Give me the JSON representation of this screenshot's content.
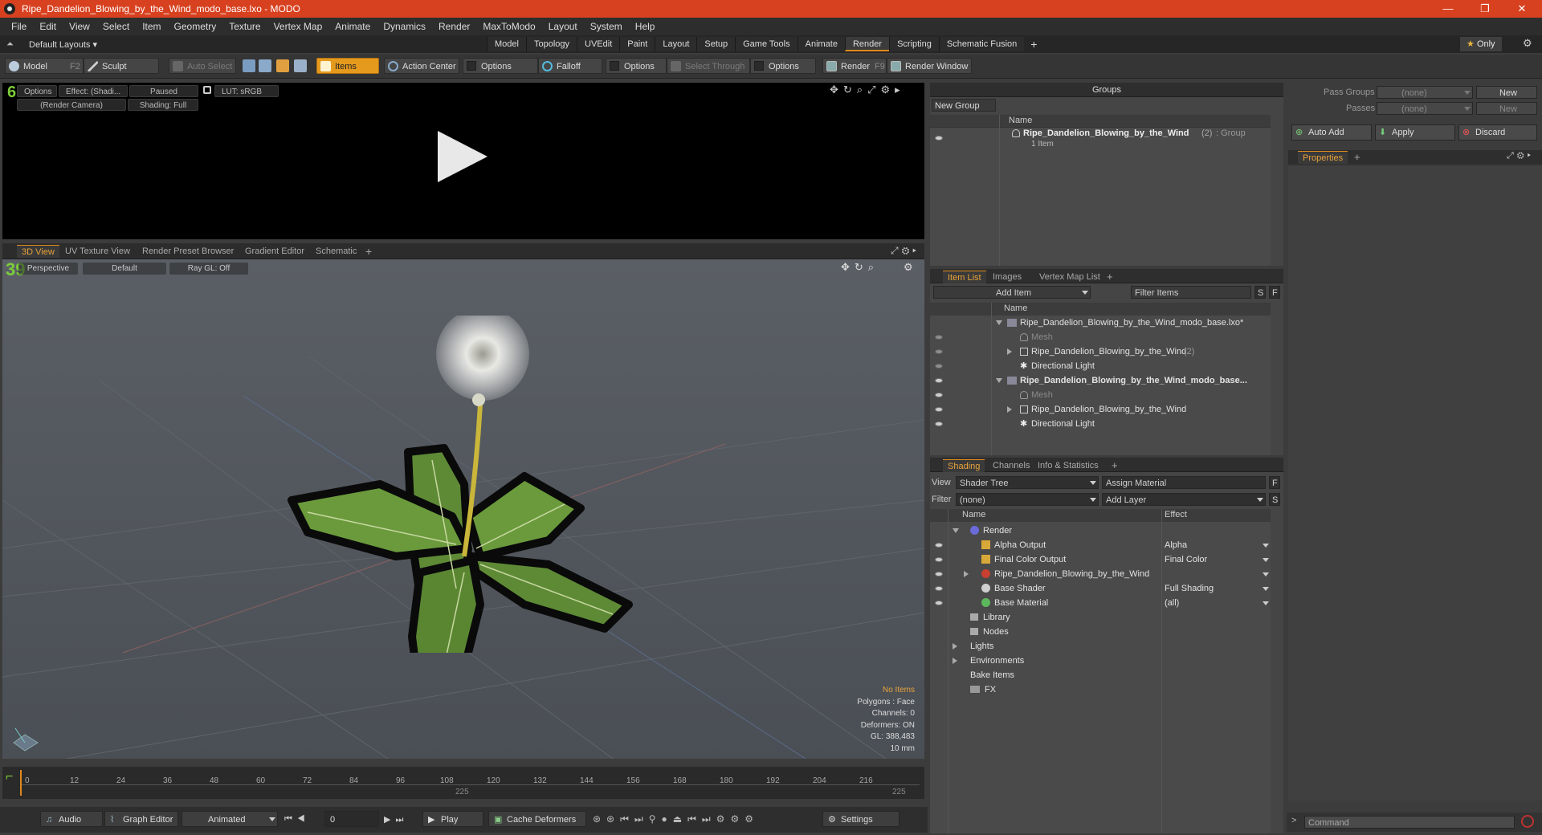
{
  "titlebar": {
    "title": "Ripe_Dandelion_Blowing_by_the_Wind_modo_base.lxo - MODO",
    "minimize": "—",
    "restore": "❐",
    "close": "✕"
  },
  "menu": [
    "File",
    "Edit",
    "View",
    "Select",
    "Item",
    "Geometry",
    "Texture",
    "Vertex Map",
    "Animate",
    "Dynamics",
    "Render",
    "MaxToModo",
    "Layout",
    "System",
    "Help"
  ],
  "layoutbar": {
    "layouts_label": "Default Layouts",
    "tabs": [
      "Model",
      "Topology",
      "UVEdit",
      "Paint",
      "Layout",
      "Setup",
      "Game Tools",
      "Animate",
      "Render",
      "Scripting",
      "Schematic Fusion"
    ],
    "active_tab": "Render",
    "only_label": "Only"
  },
  "toolbar": {
    "model": "Model",
    "model_key": "F2",
    "sculpt": "Sculpt",
    "auto_select": "Auto Select",
    "items": "Items",
    "action_center": "Action Center",
    "options1": "Options",
    "falloff": "Falloff",
    "options2": "Options",
    "select_through": "Select Through",
    "options3": "Options",
    "render": "Render",
    "render_key": "F9",
    "render_window": "Render Window"
  },
  "renderview": {
    "options": "Options",
    "effect": "Effect: (Shadi...",
    "paused": "Paused",
    "lut": "LUT: sRGB",
    "camera": "(Render Camera)",
    "shading": "Shading: Full",
    "corner_num": "6"
  },
  "viewtabs": [
    "3D View",
    "UV Texture View",
    "Render Preset Browser",
    "Gradient Editor",
    "Schematic"
  ],
  "viewport": {
    "perspective": "Perspective",
    "default": "Default",
    "raygl": "Ray GL: Off",
    "corner_num": "39"
  },
  "hud": {
    "no_items": "No Items",
    "polygons": "Polygons : Face",
    "channels": "Channels: 0",
    "deformers": "Deformers: ON",
    "gl": "GL: 388,483",
    "scale": "10 mm"
  },
  "timeline": {
    "ticks": [
      "0",
      "12",
      "24",
      "36",
      "48",
      "60",
      "72",
      "84",
      "96",
      "108",
      "120",
      "132",
      "144",
      "156",
      "168",
      "180",
      "192",
      "204",
      "216"
    ],
    "end_a": "225",
    "end_b": "225"
  },
  "bottombar": {
    "audio": "Audio",
    "graph_editor": "Graph Editor",
    "animated": "Animated",
    "frame": "0",
    "play": "Play",
    "cache_deformers": "Cache Deformers",
    "settings": "Settings"
  },
  "groups": {
    "title": "Groups",
    "new_group": "New Group",
    "col_name": "Name",
    "row_name": "Ripe_Dandelion_Blowing_by_the_Wind",
    "row_count": "(2)",
    "row_type": ": Group",
    "row_sub": "1 Item"
  },
  "itemlist": {
    "tabs": [
      "Item List",
      "Images",
      "Vertex Map List"
    ],
    "add_item": "Add Item",
    "filter_items": "Filter Items",
    "col_name": "Name",
    "rows": [
      {
        "label": "Ripe_Dandelion_Blowing_by_the_Wind_modo_base.lxo*",
        "bold": false
      },
      {
        "label": "Mesh",
        "dim": true
      },
      {
        "label": "Ripe_Dandelion_Blowing_by_the_Wind",
        "suffix": "(2)"
      },
      {
        "label": "Directional Light"
      },
      {
        "label": "Ripe_Dandelion_Blowing_by_the_Wind_modo_base...",
        "bold": true
      },
      {
        "label": "Mesh",
        "dim": true
      },
      {
        "label": "Ripe_Dandelion_Blowing_by_the_Wind"
      },
      {
        "label": "Directional Light"
      }
    ]
  },
  "shading": {
    "tabs": [
      "Shading",
      "Channels",
      "Info & Statistics"
    ],
    "view_label": "View",
    "view_value": "Shader Tree",
    "assign_material": "Assign Material",
    "filter_label": "Filter",
    "filter_value": "(none)",
    "add_layer": "Add Layer",
    "col_name": "Name",
    "col_effect": "Effect",
    "rows": [
      {
        "name": "Render",
        "effect": ""
      },
      {
        "name": "Alpha Output",
        "effect": "Alpha"
      },
      {
        "name": "Final Color Output",
        "effect": "Final Color"
      },
      {
        "name": "Ripe_Dandelion_Blowing_by_the_Wind",
        "effect": ""
      },
      {
        "name": "Base Shader",
        "effect": "Full Shading"
      },
      {
        "name": "Base Material",
        "effect": "(all)"
      },
      {
        "name": "Library",
        "effect": ""
      },
      {
        "name": "Nodes",
        "effect": ""
      },
      {
        "name": "Lights",
        "effect": ""
      },
      {
        "name": "Environments",
        "effect": ""
      },
      {
        "name": "Bake Items",
        "effect": ""
      },
      {
        "name": "FX",
        "effect": ""
      }
    ]
  },
  "passes": {
    "pass_groups_label": "Pass Groups",
    "passes_label": "Passes",
    "none": "(none)",
    "new": "New",
    "auto_add": "Auto Add",
    "apply": "Apply",
    "discard": "Discard",
    "properties": "Properties"
  },
  "command": {
    "placeholder": "Command"
  },
  "colors": {
    "accent": "#e08a1c",
    "titlebar": "#d8411f"
  }
}
